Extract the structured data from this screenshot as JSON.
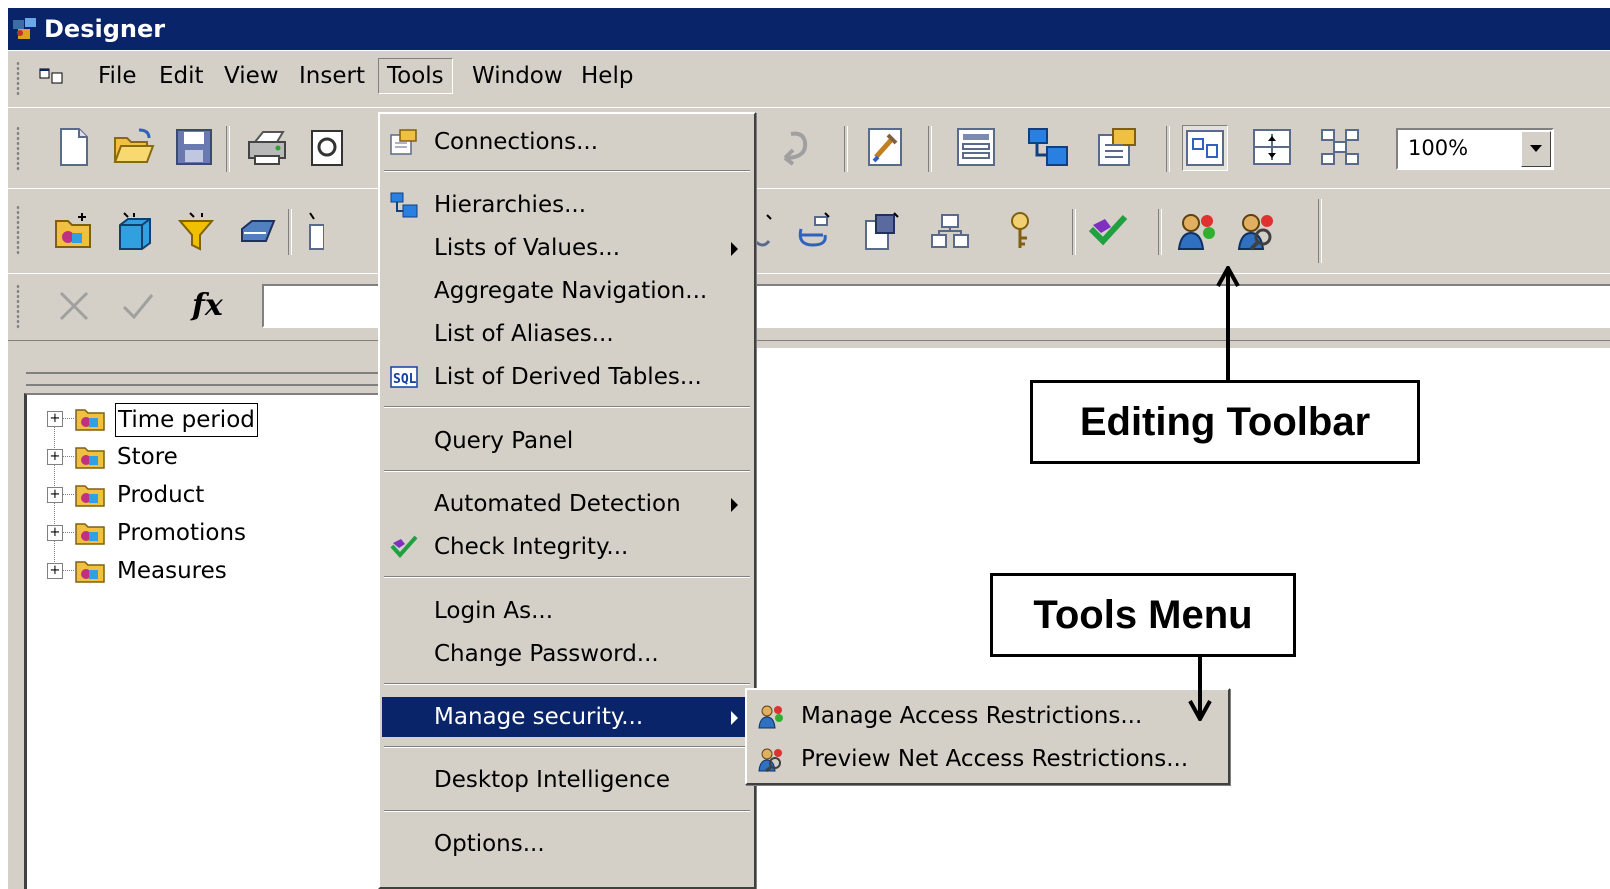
{
  "window": {
    "title": "Designer"
  },
  "menubar": {
    "items": [
      "File",
      "Edit",
      "View",
      "Insert",
      "Tools",
      "Window",
      "Help"
    ],
    "open_item": "Tools"
  },
  "toolbar": {
    "zoom_value": "100%"
  },
  "formula_bar": {
    "fx_label": "fx",
    "value": ""
  },
  "tree": {
    "items": [
      "Time period",
      "Store",
      "Product",
      "Promotions",
      "Measures"
    ],
    "selected": "Time period"
  },
  "tools_menu": {
    "items": [
      {
        "label": "Connections...",
        "icon": "connections-icon"
      },
      {
        "label": "Hierarchies...",
        "icon": "hierarchies-icon"
      },
      {
        "label": "Lists of Values...",
        "submenu": true
      },
      {
        "label": "Aggregate Navigation..."
      },
      {
        "label": "List of Aliases..."
      },
      {
        "label": "List of Derived Tables...",
        "icon": "sql-icon"
      },
      {
        "label": "Query Panel"
      },
      {
        "label": "Automated Detection",
        "submenu": true
      },
      {
        "label": "Check Integrity...",
        "icon": "check-integrity-icon"
      },
      {
        "label": "Login As..."
      },
      {
        "label": "Change Password..."
      },
      {
        "label": "Manage security...",
        "submenu": true,
        "highlighted": true
      },
      {
        "label": "Desktop Intelligence"
      },
      {
        "label": "Options..."
      }
    ]
  },
  "security_submenu": {
    "items": [
      {
        "label": "Manage Access Restrictions...",
        "icon": "manage-access-icon"
      },
      {
        "label": "Preview Net Access Restrictions...",
        "icon": "preview-access-icon"
      }
    ]
  },
  "annotations": {
    "editing_toolbar": "Editing Toolbar",
    "tools_menu": "Tools Menu"
  },
  "colors": {
    "face": "#d4d0c8",
    "titlebar": "#0a246a",
    "highlight": "#0a246a"
  }
}
